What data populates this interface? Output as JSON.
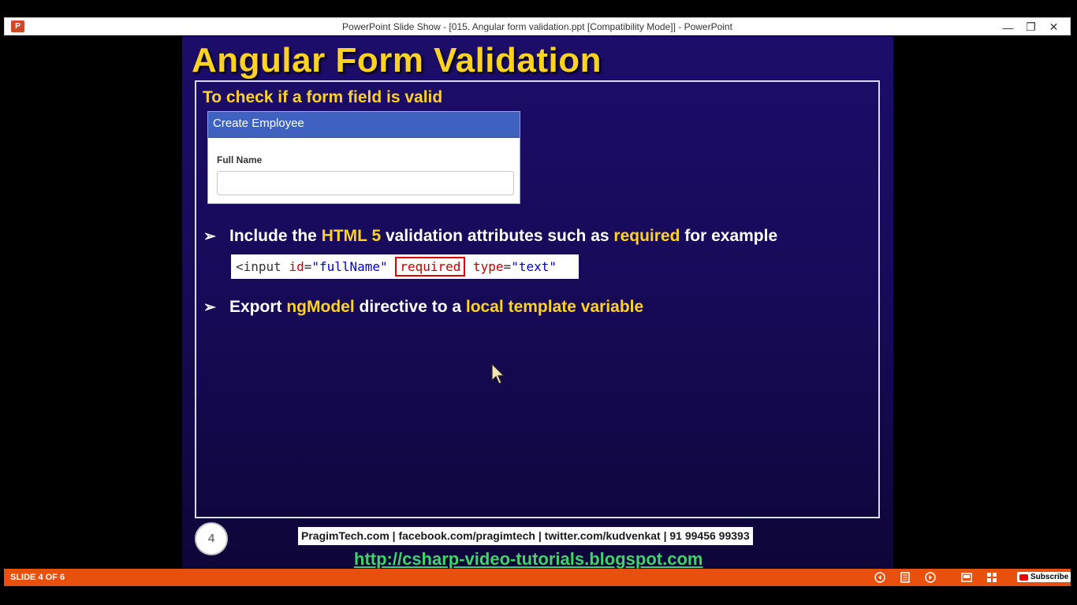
{
  "window": {
    "title": "PowerPoint Slide Show - [015. Angular form validation.ppt [Compatibility Mode]] - PowerPoint",
    "app_icon": "P",
    "minimize_label": "—",
    "restore_label": "❐",
    "close_label": "✕"
  },
  "slide": {
    "title": "Angular Form Validation",
    "subheading": "To check if a form field is valid",
    "form": {
      "heading": "Create Employee",
      "field_label": "Full Name",
      "field_value": ""
    },
    "bullets": [
      {
        "parts": [
          "Include the ",
          "HTML 5",
          " validation attributes such as ",
          "required",
          " for example"
        ]
      },
      {
        "parts": [
          "Export ",
          "ngModel",
          " directive to a ",
          "local template variable"
        ]
      }
    ],
    "code": {
      "open": "<input ",
      "attr1": "id",
      "eq1": "=",
      "val1": "\"fullName\"",
      "required": "required",
      "attr2": "type",
      "eq2": "=",
      "val2": "\"text\""
    },
    "slide_number": "4",
    "footer_text": "PragimTech.com | facebook.com/pragimtech | twitter.com/kudvenkat | 91 99456 99393",
    "footer_link": "http://csharp-video-tutorials.blogspot.com"
  },
  "status_bar": {
    "slide_counter": "SLIDE 4 OF 6",
    "icons": [
      "previous-icon",
      "notes-icon",
      "next-icon",
      "reading-view-icon",
      "slide-sorter-icon"
    ],
    "subscribe_label": "Subscribe"
  },
  "colors": {
    "accent_yellow": "#ffd320",
    "slide_bg": "#1c0d6a",
    "status_orange": "#e8500d",
    "link_green": "#3fd46a",
    "panel_blue": "#3f62c1"
  }
}
